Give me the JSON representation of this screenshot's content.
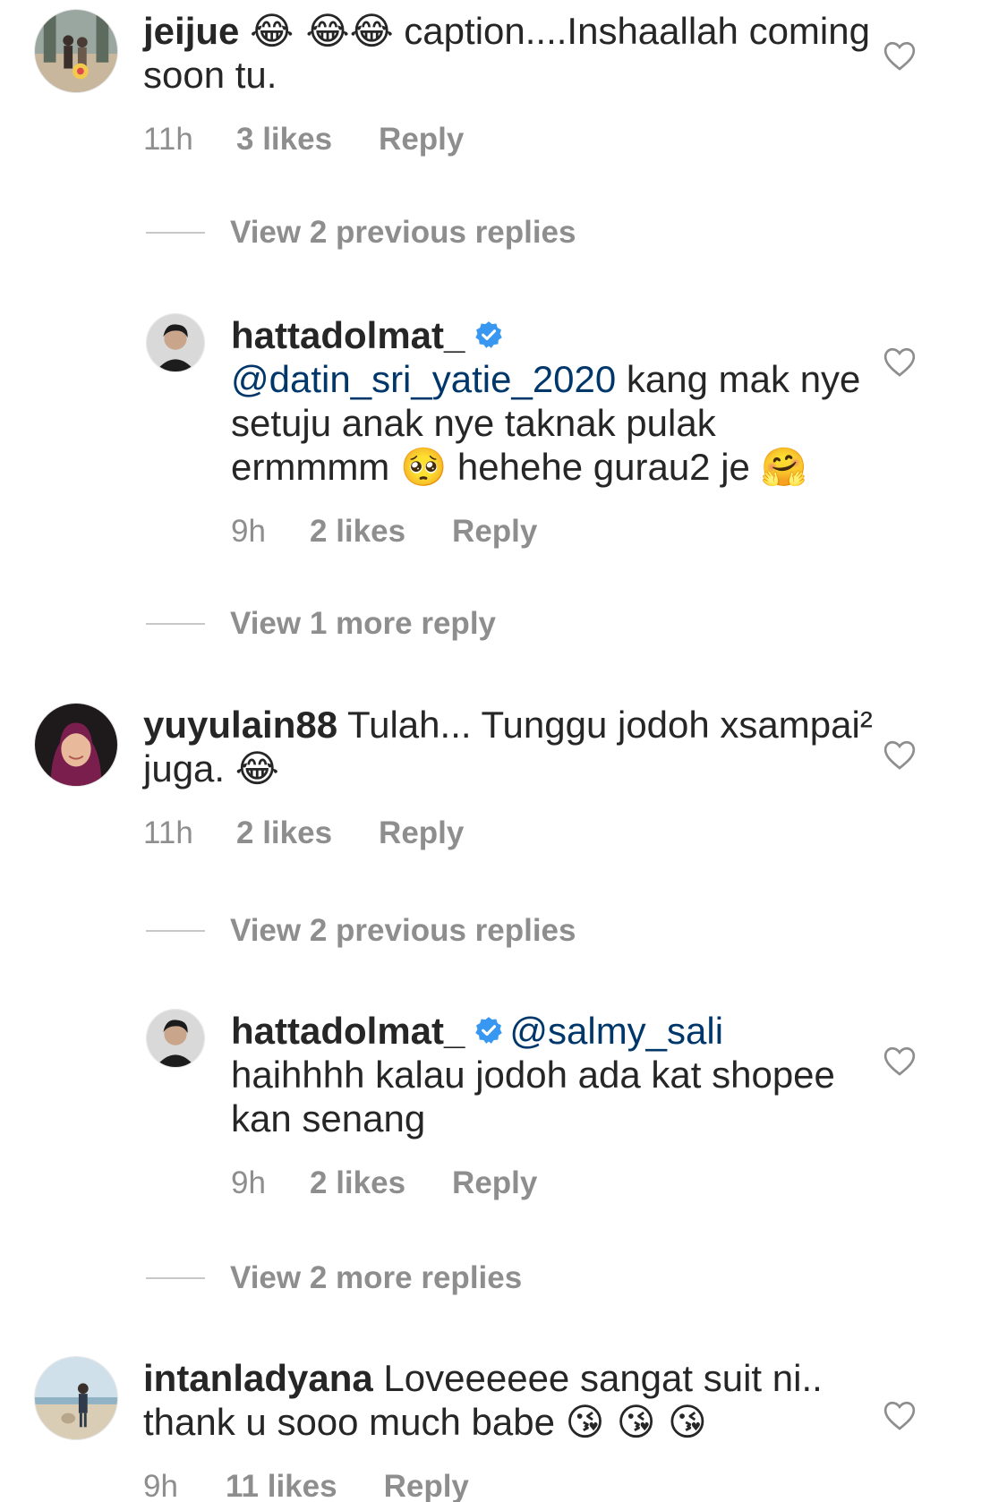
{
  "comments": [
    {
      "username": "jeijue",
      "emoji_before": "😂 😂😂",
      "text": " caption....Inshaallah coming soon tu.",
      "time": "11h",
      "likes": "3 likes",
      "reply": "Reply"
    },
    {
      "username": "yuyulain88",
      "text": " Tulah... Tunggu jodoh xsampai² juga. ",
      "emoji_after": "😂",
      "time": "11h",
      "likes": "2 likes",
      "reply": "Reply"
    },
    {
      "username": "intanladyana",
      "text": " Loveeeeee sangat suit ni.. thank u sooo much babe ",
      "emoji_after": "😘 😘 😘",
      "time": "9h",
      "likes": "11 likes",
      "reply": "Reply"
    }
  ],
  "replies": [
    {
      "username": "hattadolmat_",
      "mention": "@datin_sri_yatie_2020",
      "text_a": "  kang mak nye setuju anak nye taknak pulak ermmmm ",
      "emoji_a": "🥺",
      "text_b": " hehehe gurau2 je ",
      "emoji_b": "🤗",
      "time": "9h",
      "likes": "2 likes",
      "reply": "Reply"
    },
    {
      "username": "hattadolmat_",
      "mention": "@salmy_sali",
      "text_a": " haihhhh kalau jodoh ada kat shopee kan senang",
      "time": "9h",
      "likes": "2 likes",
      "reply": "Reply"
    }
  ],
  "view_links": {
    "v1": "View 2 previous replies",
    "v2": "View 1 more reply",
    "v3": "View 2 previous replies",
    "v4": "View 2 more replies"
  },
  "colors": {
    "text": "#262626",
    "secondary": "#8e8e8e",
    "mention": "#00376b",
    "verified": "#3897f0"
  }
}
